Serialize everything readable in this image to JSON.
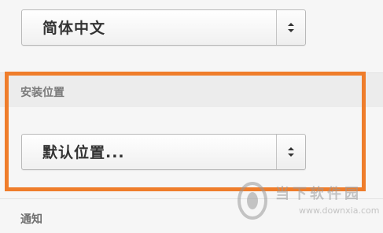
{
  "language_select": {
    "value": "简体中文"
  },
  "install_location": {
    "section_label": "安装位置",
    "select_value": "默认位置..."
  },
  "notifications": {
    "section_label": "通知"
  },
  "highlight_color": "#ef7d2b",
  "watermark": {
    "title": "当下软件园",
    "url": "www.downxia.com"
  },
  "icons": {
    "select_arrows": "updown-chevron-icon",
    "watermark_logo": "downxia-logo-icon"
  }
}
